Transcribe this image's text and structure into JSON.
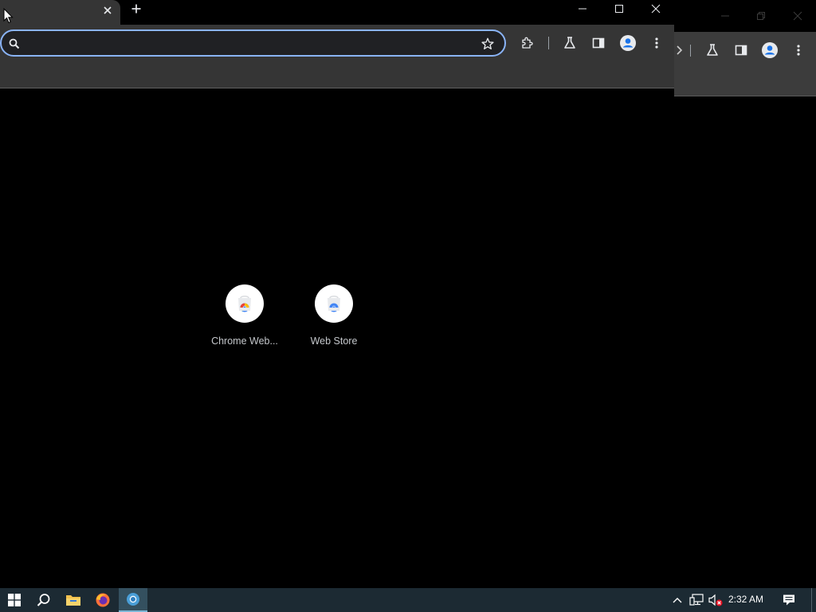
{
  "browser": {
    "tab": {
      "title": "",
      "close_icon": "close-icon"
    },
    "new_tab_icon": "plus-icon",
    "window_controls": [
      "minimize-icon",
      "maximize-icon",
      "close-icon"
    ],
    "omnibox": {
      "value": "",
      "placeholder": "",
      "accent": "#8ab4f8"
    },
    "toolbar_icons": [
      "extensions-icon",
      "labs-icon",
      "side-panel-icon",
      "profile-icon",
      "menu-icon"
    ]
  },
  "new_tab_page": {
    "shortcuts": [
      {
        "label": "Chrome Web...",
        "icon": "chrome-web-store-icon"
      },
      {
        "label": "Web Store",
        "icon": "web-store-icon"
      }
    ]
  },
  "taskbar": {
    "apps": [
      "windows-start-icon",
      "search-icon",
      "file-explorer-icon",
      "firefox-icon",
      "chrome-icon"
    ],
    "active_app": "chrome-icon",
    "tray": [
      "chevron-up-icon",
      "network-icon",
      "volume-muted-icon"
    ],
    "time": "2:32 AM",
    "notification_icon": "notification-icon"
  },
  "colors": {
    "frame": "#000000",
    "toolbar": "#353535",
    "taskbar": "#1c2a33"
  }
}
